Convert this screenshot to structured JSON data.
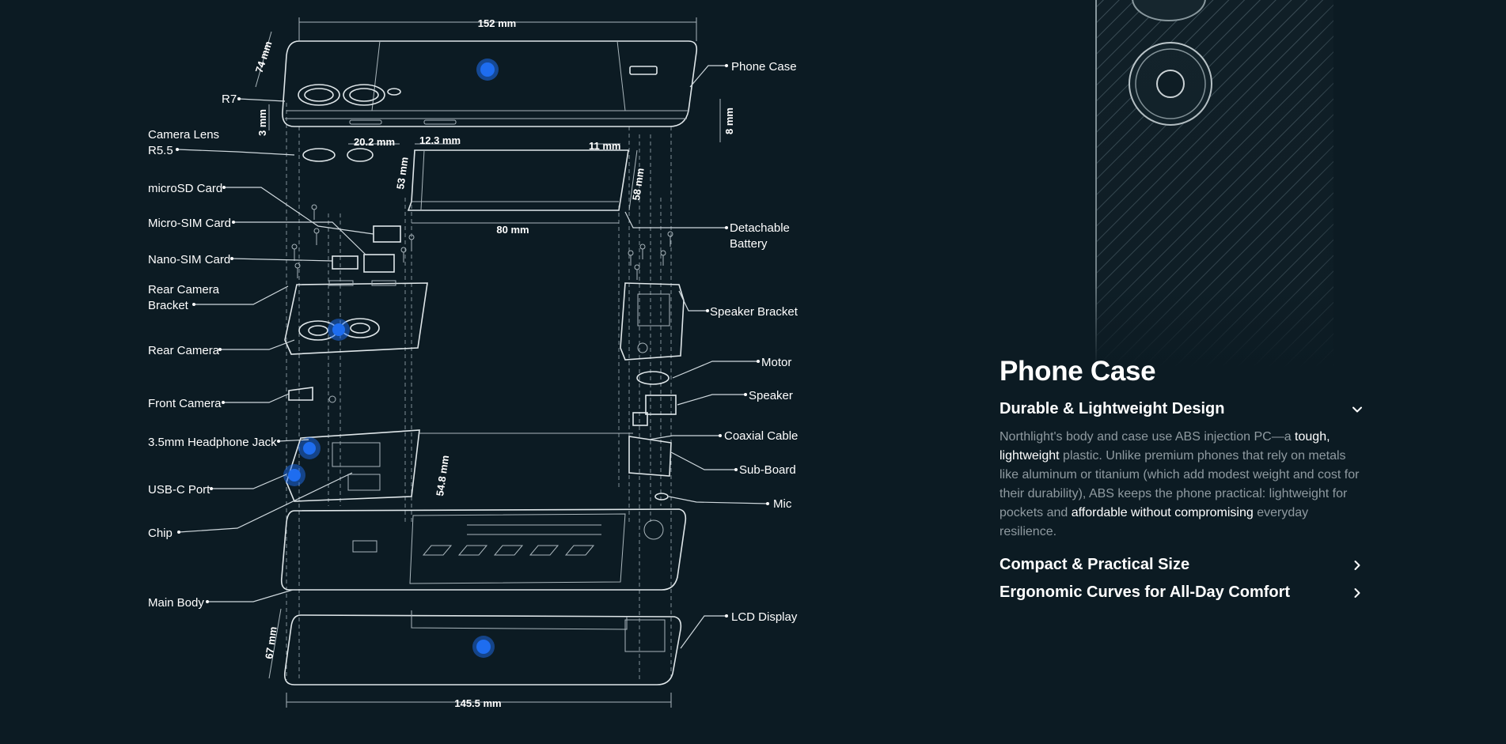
{
  "diagram": {
    "dimensions": {
      "top_width": "152 mm",
      "top_height": "74 mm",
      "corner_radius": "R7",
      "case_thickness": "3 mm",
      "bottom_thickness": "8 mm",
      "lens_spacing": "20.2 mm",
      "button_spacing": "12.3 mm",
      "port_width": "11 mm",
      "battery_height_left": "53 mm",
      "battery_height_right": "58 mm",
      "battery_width": "80 mm",
      "board_height": "54.8 mm",
      "lcd_height": "67 mm",
      "lcd_width": "145.5 mm"
    },
    "labels_left": {
      "camera_lens_1": "Camera Lens",
      "camera_lens_2": "R5.5",
      "microsd": "microSD Card",
      "micro_sim": "Micro-SIM Card",
      "nano_sim": "Nano-SIM Card",
      "rear_bracket_1": "Rear Camera",
      "rear_bracket_2": "Bracket",
      "rear_camera": "Rear Camera",
      "front_camera": "Front Camera",
      "headphone": "3.5mm Headphone Jack",
      "usbc": "USB-C Port",
      "chip": "Chip",
      "main_body": "Main Body"
    },
    "labels_right": {
      "phone_case": "Phone Case",
      "battery_1": "Detachable",
      "battery_2": "Battery",
      "speaker_bracket": "Speaker Bracket",
      "motor": "Motor",
      "speaker": "Speaker",
      "coaxial": "Coaxial Cable",
      "subboard": "Sub-Board",
      "mic": "Mic",
      "lcd": "LCD Display"
    }
  },
  "panel": {
    "title": "Phone Case",
    "items": [
      {
        "title": "Durable & Lightweight Design",
        "expanded": true,
        "body": {
          "t1": "Northlight's body and case use ABS injection PC—a ",
          "h1": "tough, lightweight",
          "t2": " plastic. Unlike premium phones that rely on metals like aluminum or titanium (which add modest weight and cost for their durability), ABS keeps the phone practical: lightweight for pockets and ",
          "h2": "affordable without compromising",
          "t3": " everyday resilience."
        }
      },
      {
        "title": "Compact & Practical Size",
        "expanded": false
      },
      {
        "title": "Ergonomic Curves for All-Day Comfort",
        "expanded": false
      }
    ]
  },
  "colors": {
    "background": "#0c1b23",
    "line": "#dfe6e9",
    "hotspot": "#1e6df0",
    "muted_text": "#8f9aa0"
  },
  "icons": [
    "chevron-down-icon",
    "chevron-right-icon"
  ]
}
